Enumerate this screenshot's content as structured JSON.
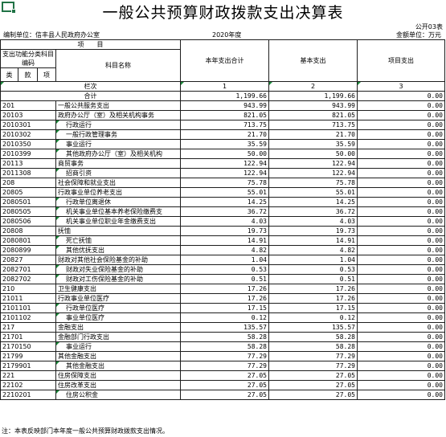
{
  "title": "一般公共预算财政拨款支出决算表",
  "form_code": "公开03表",
  "unit_label": "编制单位：信丰县人民政府办公室",
  "year": "2020年度",
  "currency": "金额单位：万元",
  "header": {
    "item": "项　　目",
    "func_code": "支出功能分类科目编码",
    "subject_name": "科目名称",
    "cat": "类",
    "section": "款",
    "subitem": "项",
    "total_col": "本年支出合计",
    "basic_col": "基本支出",
    "project_col": "项目支出",
    "row_label": "栏次",
    "col1": "1",
    "col2": "2",
    "col3": "3",
    "sum_label": "合计",
    "sum_total": "1,199.66",
    "sum_basic": "1,199.66",
    "sum_project": "0.00"
  },
  "rows": [
    {
      "code": "201",
      "name": "一般公共服务支出",
      "total": "943.99",
      "basic": "943.99",
      "project": "0.00",
      "indent": false
    },
    {
      "code": "20103",
      "name": "政府办公厅（室）及相关机构事务",
      "total": "821.05",
      "basic": "821.05",
      "project": "0.00",
      "indent": false
    },
    {
      "code": "2010301",
      "name": "行政运行",
      "total": "713.75",
      "basic": "713.75",
      "project": "0.00",
      "indent": true
    },
    {
      "code": "2010302",
      "name": "一般行政管理事务",
      "total": "21.70",
      "basic": "21.70",
      "project": "0.00",
      "indent": true
    },
    {
      "code": "2010350",
      "name": "事业运行",
      "total": "35.59",
      "basic": "35.59",
      "project": "0.00",
      "indent": true
    },
    {
      "code": "2010399",
      "name": "其他政府办公厅（室）及相关机构",
      "total": "50.00",
      "basic": "50.00",
      "project": "0.00",
      "indent": true
    },
    {
      "code": "20113",
      "name": "商贸事务",
      "total": "122.94",
      "basic": "122.94",
      "project": "0.00",
      "indent": false
    },
    {
      "code": "2011308",
      "name": "招商引资",
      "total": "122.94",
      "basic": "122.94",
      "project": "0.00",
      "indent": true
    },
    {
      "code": "208",
      "name": "社会保障和就业支出",
      "total": "75.78",
      "basic": "75.78",
      "project": "0.00",
      "indent": false
    },
    {
      "code": "20805",
      "name": "行政事业单位养老支出",
      "total": "55.01",
      "basic": "55.01",
      "project": "0.00",
      "indent": false
    },
    {
      "code": "2080501",
      "name": "行政单位离退休",
      "total": "14.25",
      "basic": "14.25",
      "project": "0.00",
      "indent": true
    },
    {
      "code": "2080505",
      "name": "机关事业单位基本养老保险缴费支",
      "total": "36.72",
      "basic": "36.72",
      "project": "0.00",
      "indent": true
    },
    {
      "code": "2080506",
      "name": "机关事业单位职业年金缴费支出",
      "total": "4.03",
      "basic": "4.03",
      "project": "0.00",
      "indent": true
    },
    {
      "code": "20808",
      "name": "抚恤",
      "total": "19.73",
      "basic": "19.73",
      "project": "0.00",
      "indent": false
    },
    {
      "code": "2080801",
      "name": "死亡抚恤",
      "total": "14.91",
      "basic": "14.91",
      "project": "0.00",
      "indent": true
    },
    {
      "code": "2080899",
      "name": "其他优抚支出",
      "total": "4.82",
      "basic": "4.82",
      "project": "0.00",
      "indent": true
    },
    {
      "code": "20827",
      "name": "财政对其他社会保险基金的补助",
      "total": "1.04",
      "basic": "1.04",
      "project": "0.00",
      "indent": false
    },
    {
      "code": "2082701",
      "name": "财政对失业保险基金的补助",
      "total": "0.53",
      "basic": "0.53",
      "project": "0.00",
      "indent": true
    },
    {
      "code": "2082702",
      "name": "财政对工伤保险基金的补助",
      "total": "0.51",
      "basic": "0.51",
      "project": "0.00",
      "indent": true
    },
    {
      "code": "210",
      "name": "卫生健康支出",
      "total": "17.26",
      "basic": "17.26",
      "project": "0.00",
      "indent": false
    },
    {
      "code": "21011",
      "name": "行政事业单位医疗",
      "total": "17.26",
      "basic": "17.26",
      "project": "0.00",
      "indent": false
    },
    {
      "code": "2101101",
      "name": "行政单位医疗",
      "total": "17.15",
      "basic": "17.15",
      "project": "0.00",
      "indent": true
    },
    {
      "code": "2101102",
      "name": "事业单位医疗",
      "total": "0.12",
      "basic": "0.12",
      "project": "0.00",
      "indent": true
    },
    {
      "code": "217",
      "name": "金融支出",
      "total": "135.57",
      "basic": "135.57",
      "project": "0.00",
      "indent": false
    },
    {
      "code": "21701",
      "name": "金融部门行政支出",
      "total": "58.28",
      "basic": "58.28",
      "project": "0.00",
      "indent": false
    },
    {
      "code": "2170150",
      "name": "事业运行",
      "total": "58.28",
      "basic": "58.28",
      "project": "0.00",
      "indent": true
    },
    {
      "code": "21799",
      "name": "其他金融支出",
      "total": "77.29",
      "basic": "77.29",
      "project": "0.00",
      "indent": false
    },
    {
      "code": "2179901",
      "name": "其他金融支出",
      "total": "77.29",
      "basic": "77.29",
      "project": "0.00",
      "indent": true
    },
    {
      "code": "221",
      "name": "住房保障支出",
      "total": "27.05",
      "basic": "27.05",
      "project": "0.00",
      "indent": false
    },
    {
      "code": "22102",
      "name": "住房改革支出",
      "total": "27.05",
      "basic": "27.05",
      "project": "0.00",
      "indent": false
    },
    {
      "code": "2210201",
      "name": "住房公积金",
      "total": "27.05",
      "basic": "27.05",
      "project": "0.00",
      "indent": true
    }
  ],
  "note": "注：本表反映部门本年度一般公共预算财政拨款支出情况。"
}
